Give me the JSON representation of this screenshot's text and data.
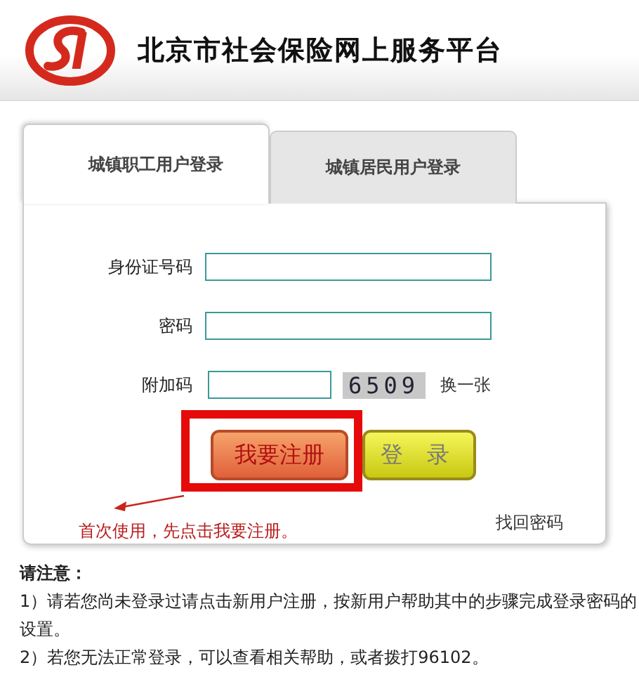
{
  "header": {
    "title": "北京市社会保险网上服务平台"
  },
  "tabs": [
    {
      "label": "城镇职工用户登录",
      "selected": true
    },
    {
      "label": "城镇居民用户登录",
      "selected": false
    }
  ],
  "fields": [
    {
      "kind": "text",
      "label": "身份证号码"
    },
    {
      "kind": "password",
      "label": "密码"
    },
    {
      "kind": "captcha",
      "label": "附加码",
      "code": "6509",
      "refresh": "换一张"
    }
  ],
  "buttons": [
    {
      "kind": "register",
      "label": "我要注册",
      "highlighted": true
    },
    {
      "kind": "login",
      "label": "登 录",
      "highlighted": false
    }
  ],
  "annotation": "首次使用，先点击我要注册。",
  "forgot_link": "找回密码",
  "notice": {
    "title": "请注意：",
    "lines": [
      "1）请若您尚未登录过请点击新用户注册，按新用户帮助其中的步骤完成登录密码的设置。",
      "2）若您无法正常登录，可以查看相关帮助，或者拨打96102。"
    ]
  }
}
